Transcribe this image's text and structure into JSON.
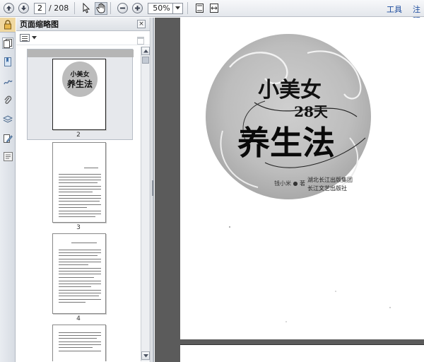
{
  "toolbar": {
    "current_page": "2",
    "page_total": "/ 208",
    "zoom": "50%",
    "tools_label": "工具",
    "comment_label": "注释"
  },
  "thumbnail_panel": {
    "title": "页面缩略图",
    "thumbnails": [
      {
        "page": "2",
        "selected": true
      },
      {
        "page": "3",
        "selected": false
      },
      {
        "page": "4",
        "selected": false
      }
    ]
  },
  "cover": {
    "title_line1": "小美女",
    "title_number": "28天",
    "title_line2": "养生法",
    "author": "钱小米 ● 著",
    "publisher_line1": "湖北长江出版集团",
    "publisher_line2": "长江文艺出版社"
  },
  "colors": {
    "toolbar_bg": "#e4e7ec",
    "doc_bg": "#5b5b5b",
    "link": "#1a4a9c",
    "lock": "#f0d8a0"
  },
  "icons": [
    "page-up-icon",
    "page-down-icon",
    "select-arrow-icon",
    "hand-icon",
    "zoom-out-icon",
    "zoom-in-icon",
    "fit-page-icon",
    "fit-width-icon",
    "lock-icon",
    "pages-icon",
    "bookmarks-icon",
    "attachments-icon",
    "layers-icon",
    "signatures-icon",
    "trash-icon"
  ]
}
